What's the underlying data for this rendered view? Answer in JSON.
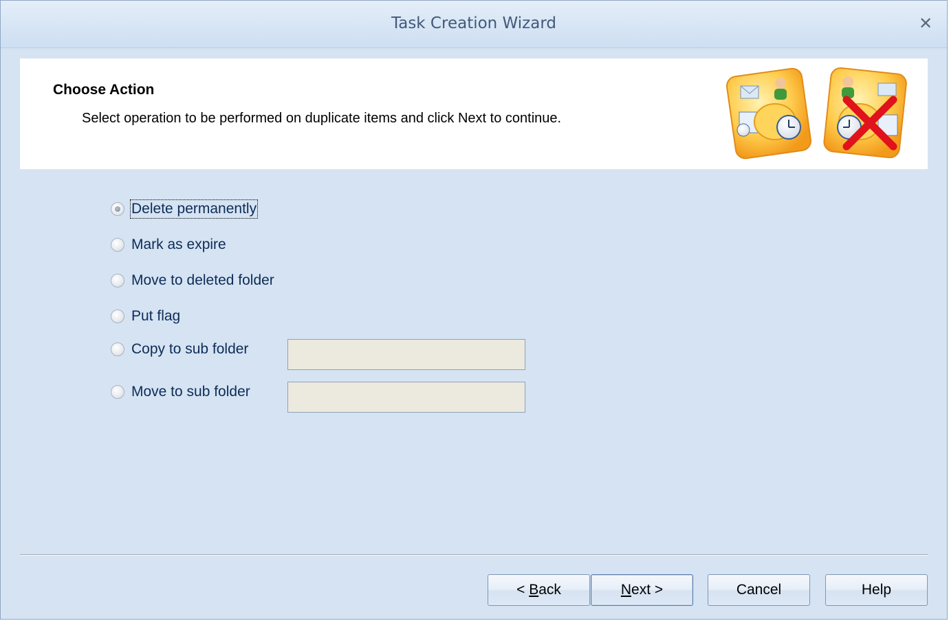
{
  "window": {
    "title": "Task Creation Wizard",
    "close_symbol": "✕"
  },
  "header": {
    "title": "Choose Action",
    "subtitle": "Select operation to be performed on duplicate items and click Next to continue."
  },
  "options": [
    {
      "label": "Delete permanently",
      "selected": true
    },
    {
      "label": "Mark as expire",
      "selected": false
    },
    {
      "label": "Move to deleted folder",
      "selected": false
    },
    {
      "label": "Put flag",
      "selected": false
    },
    {
      "label": "Copy to sub folder",
      "selected": false
    },
    {
      "label": "Move to sub folder",
      "selected": false
    }
  ],
  "fields": {
    "copy_folder_value": "",
    "move_folder_value": ""
  },
  "buttons": {
    "back": {
      "prefix": "< ",
      "access": "B",
      "rest": "ack"
    },
    "next": {
      "access": "N",
      "rest": "ext >"
    },
    "cancel": "Cancel",
    "help": "Help"
  },
  "colors": {
    "window_bg": "#d5e3f2",
    "title_text": "#41597a",
    "option_text": "#0d2c58",
    "header_bg": "#ffffff"
  }
}
